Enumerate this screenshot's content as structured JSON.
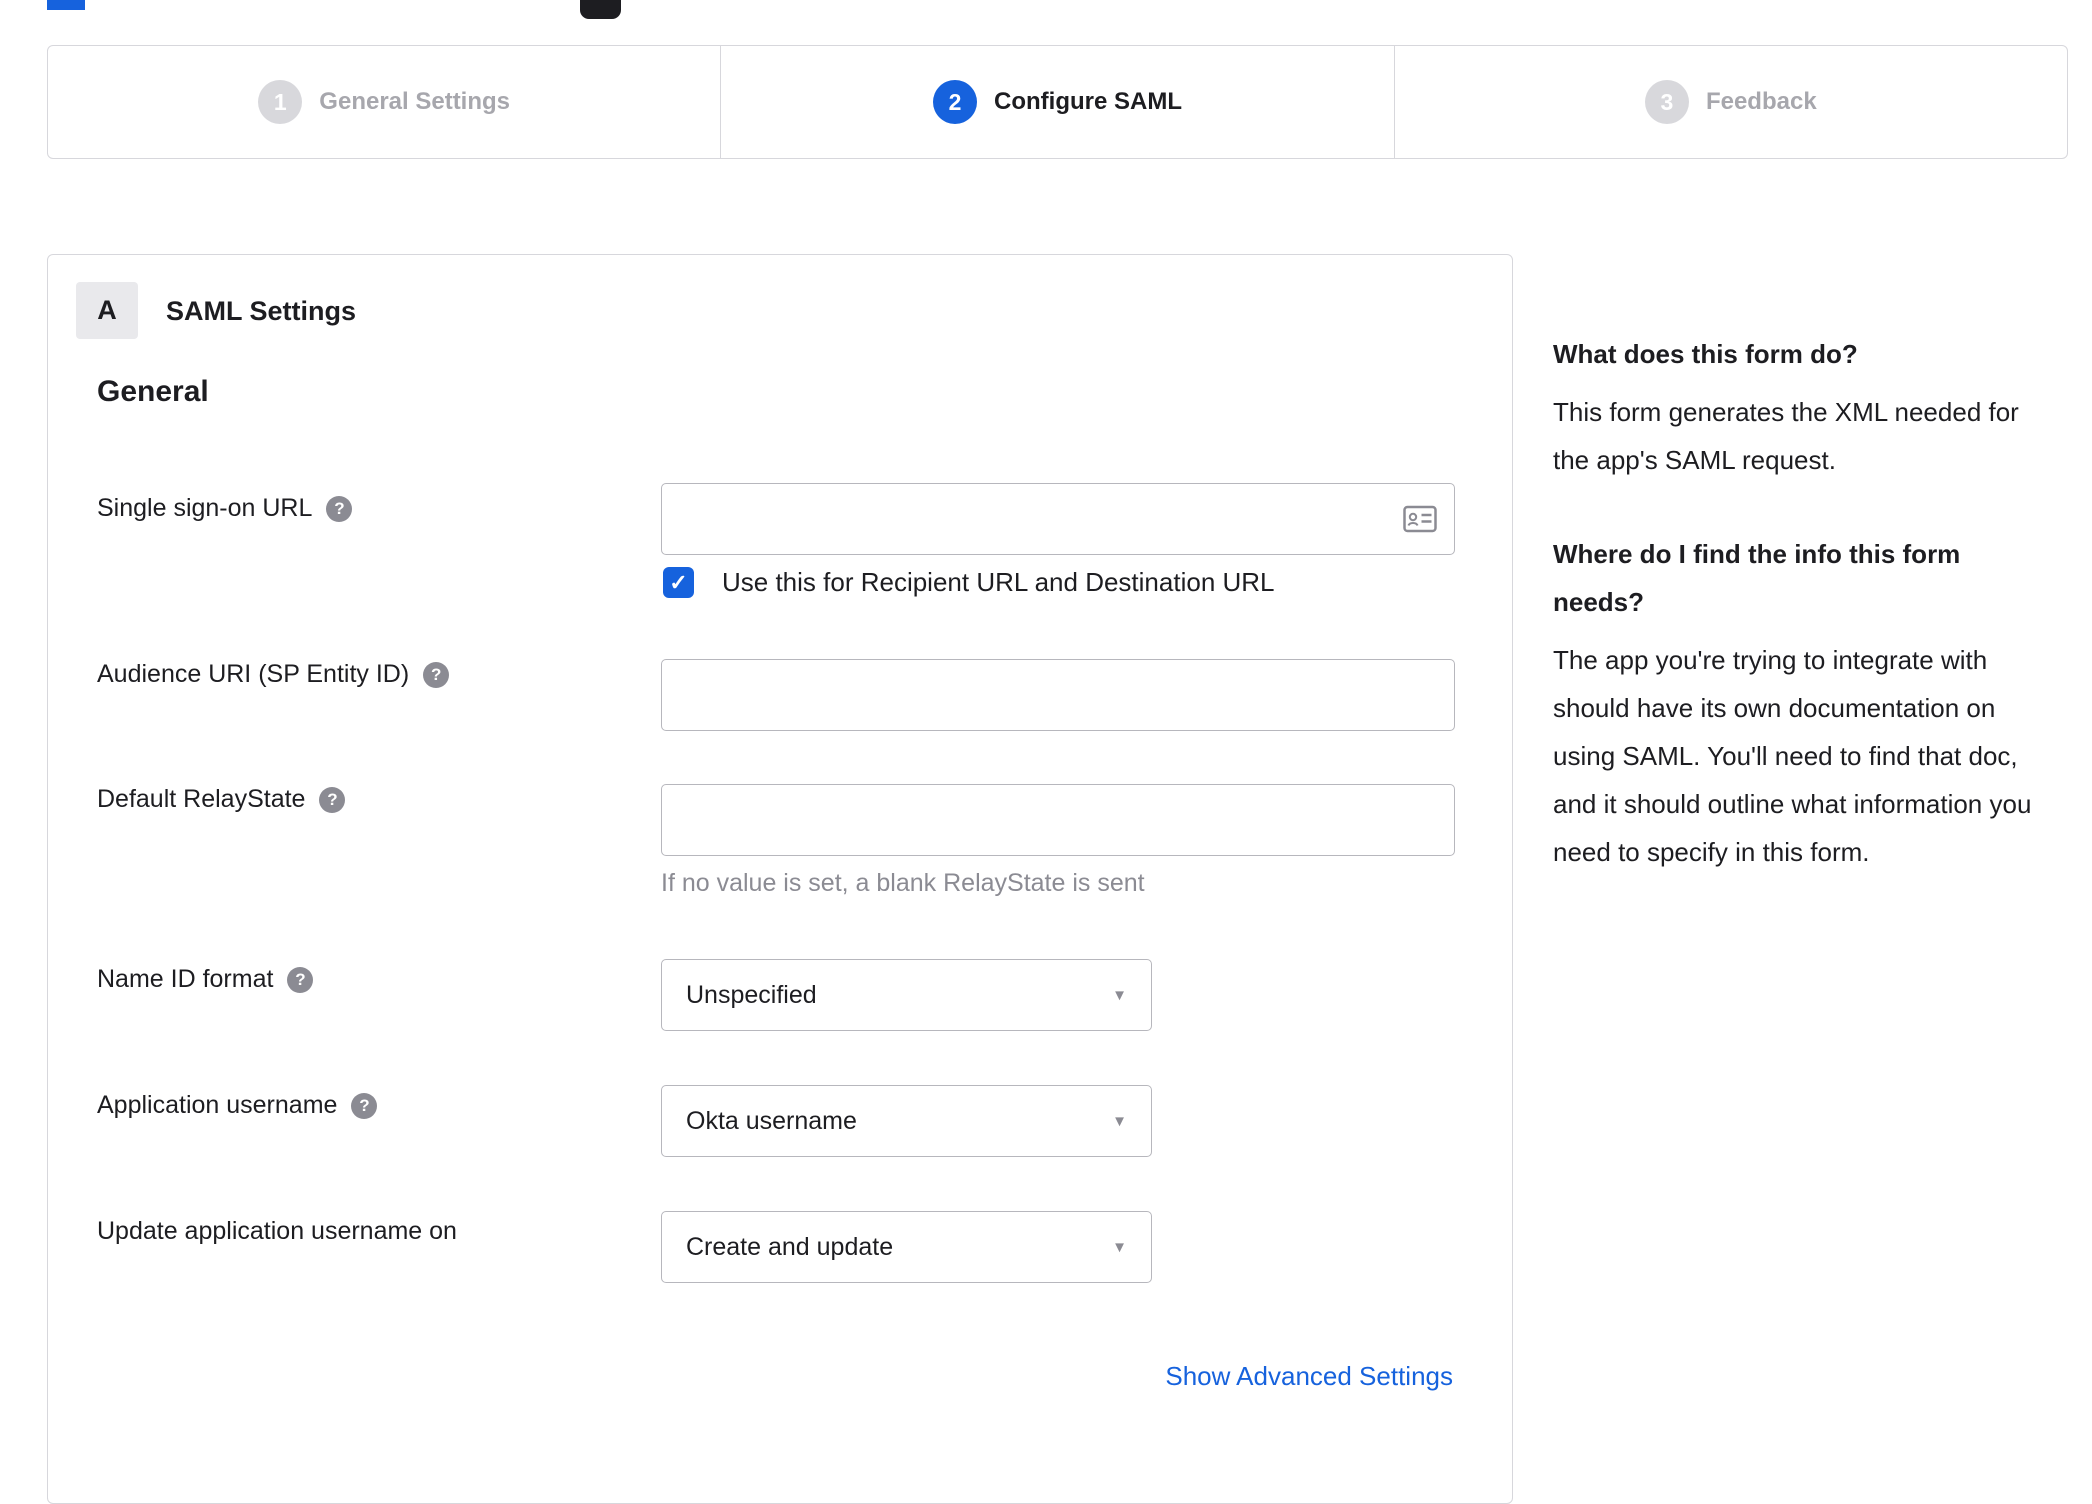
{
  "accent_color": "#1662dd",
  "stepper": {
    "steps": [
      {
        "number": "1",
        "label": "General Settings",
        "state": "inactive"
      },
      {
        "number": "2",
        "label": "Configure SAML",
        "state": "active"
      },
      {
        "number": "3",
        "label": "Feedback",
        "state": "inactive"
      }
    ]
  },
  "panel": {
    "section_badge": "A",
    "section_title": "SAML Settings",
    "group_title": "General",
    "fields": {
      "sso_url": {
        "label": "Single sign-on URL",
        "value": "",
        "icon": "contact-card-icon",
        "checkbox_label": "Use this for Recipient URL and Destination URL",
        "checkbox_checked": true,
        "checkmark": "✓"
      },
      "audience_uri": {
        "label": "Audience URI (SP Entity ID)",
        "value": ""
      },
      "relay_state": {
        "label": "Default RelayState",
        "value": "",
        "helper": "If no value is set, a blank RelayState is sent"
      },
      "name_id_format": {
        "label": "Name ID format",
        "value": "Unspecified"
      },
      "app_username": {
        "label": "Application username",
        "value": "Okta username"
      },
      "update_app_username": {
        "label": "Update application username on",
        "value": "Create and update"
      }
    },
    "help_icon_glyph": "?",
    "advanced_link": "Show Advanced Settings"
  },
  "sidebar": {
    "sections": [
      {
        "heading": "What does this form do?",
        "body": "This form generates the XML needed for the app's SAML request."
      },
      {
        "heading": "Where do I find the info this form needs?",
        "body": "The app you're trying to integrate with should have its own documentation on using SAML. You'll need to find that doc, and it should outline what information you need to specify in this form."
      }
    ]
  }
}
